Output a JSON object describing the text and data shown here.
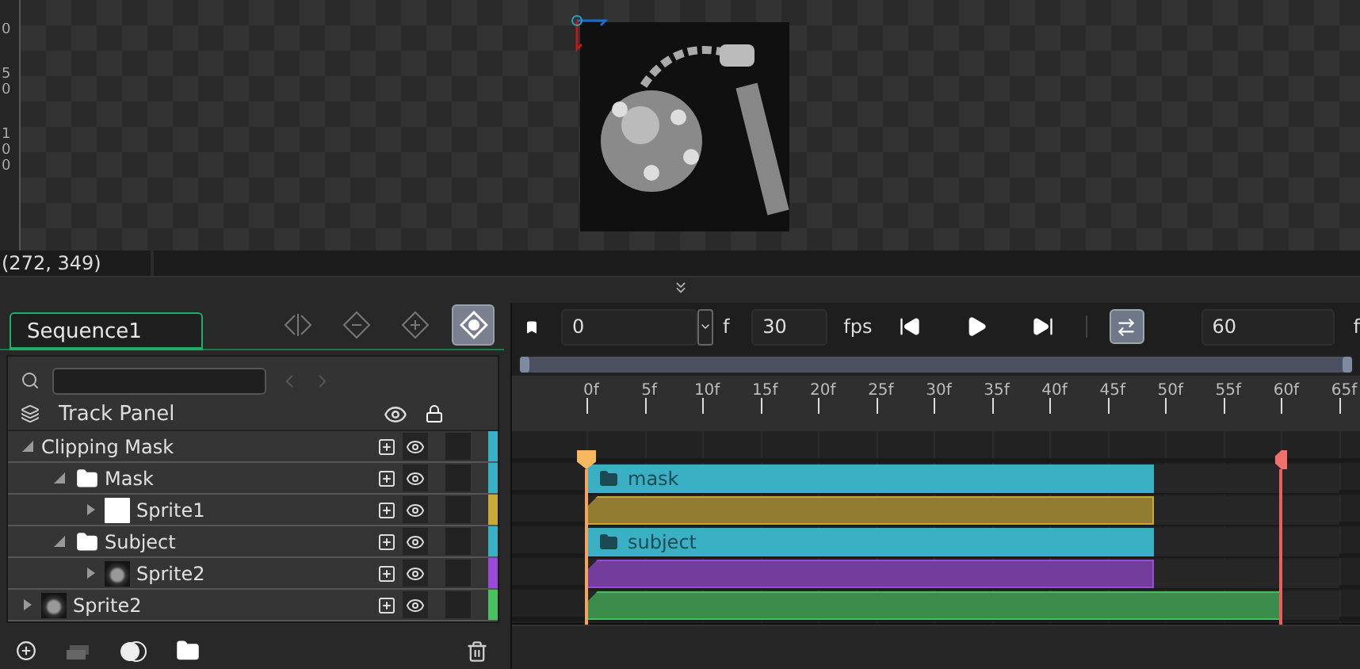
{
  "viewport": {
    "ruler_labels": [
      [
        "0"
      ],
      [
        "5",
        "0"
      ],
      [
        "1",
        "0",
        "0"
      ]
    ],
    "coordinates": "(272, 349)"
  },
  "sequence_tab": {
    "label": "Sequence1",
    "selected": true
  },
  "keyframe_buttons": [
    {
      "kind": "split",
      "selected": false
    },
    {
      "kind": "remove",
      "selected": false
    },
    {
      "kind": "add",
      "selected": false
    },
    {
      "kind": "record",
      "selected": true
    }
  ],
  "track_panel": {
    "title": "Track Panel",
    "tracks": [
      {
        "name": "Clipping Mask",
        "kind": "group",
        "expanded": true,
        "color": "#3ab0c4",
        "children": [
          {
            "name": "Mask",
            "kind": "folder",
            "expanded": true,
            "color": "#3ab0c4",
            "clip": {
              "label": "mask",
              "level": 0.754
            },
            "children": [
              {
                "name": "Sprite1",
                "kind": "white-sprite",
                "expanded": false,
                "color": "#c8a838",
                "clip": {
                  "level": 0.754
                }
              }
            ]
          },
          {
            "name": "Subject",
            "kind": "folder",
            "expanded": true,
            "color": "#3ab0c4",
            "clip": {
              "label": "subject",
              "level": 0.754
            },
            "children": [
              {
                "name": "Sprite2",
                "kind": "image-sprite",
                "expanded": false,
                "color": "#9a4ad8",
                "clip": {
                  "level": 0.754
                }
              }
            ]
          }
        ]
      },
      {
        "name": "Sprite2",
        "kind": "image-sprite",
        "expanded": false,
        "color": "#48c060",
        "clip": {
          "level": 0.923
        }
      }
    ]
  },
  "transport": {
    "frame": "0",
    "frame_unit": "f",
    "fps": "30",
    "fps_unit": "fps",
    "loop": {
      "selected": true
    },
    "end_frame": "60",
    "end_unit": "f"
  },
  "timeline": {
    "range": {
      "level": 1
    },
    "ruler_labels": [
      "0f",
      "5f",
      "10f",
      "15f",
      "20f",
      "25f",
      "30f",
      "35f",
      "40f",
      "45f",
      "50f",
      "55f",
      "60f",
      "65f"
    ]
  }
}
